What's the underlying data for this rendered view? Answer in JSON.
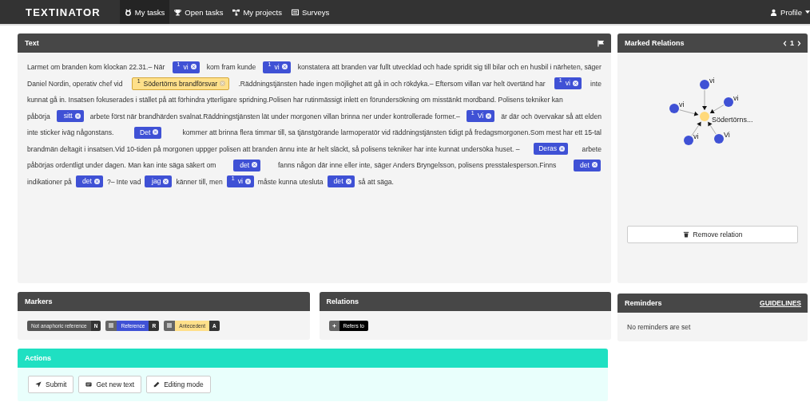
{
  "navbar": {
    "brand": "TEXTINATOR",
    "items": [
      {
        "label": "My tasks",
        "selected": true
      },
      {
        "label": "Open tasks",
        "selected": false
      },
      {
        "label": "My projects",
        "selected": false
      },
      {
        "label": "Surveys",
        "selected": false
      }
    ],
    "profile": "Profile"
  },
  "text_panel": {
    "title": "Text",
    "lines": [
      [
        {
          "kind": "text",
          "text": "Larmet om branden kom klockan 22.31.– När"
        },
        {
          "kind": "reference",
          "badge": "1",
          "text": "vi"
        },
        {
          "kind": "text",
          "text": "kom fram kunde"
        },
        {
          "kind": "reference",
          "badge": "1",
          "text": "vi"
        },
        {
          "kind": "text",
          "text": "konstatera att branden var fullt utvecklad och hade spridit sig till bilar och en husbil i närheten, säger"
        }
      ],
      [
        {
          "kind": "text",
          "text": "Daniel Nordin, operativ chef vid"
        },
        {
          "kind": "antecedent",
          "badge": "1",
          "text": "Södertörns brandförsvar"
        },
        {
          "kind": "text",
          "text": ".Räddningstjänsten hade ingen möjlighet att gå in och rökdyka.– Eftersom villan var helt övertänd har"
        },
        {
          "kind": "reference",
          "badge": "1",
          "text": "vi"
        },
        {
          "kind": "text",
          "text": "inte"
        }
      ],
      [
        {
          "kind": "text",
          "text": "kunnat gå in. Insatsen fokuserades i stället på att förhindra ytterligare spridning.Polisen har rutinmässigt inlett en förundersökning om misstänkt mordband. Polisens tekniker kan"
        }
      ],
      [
        {
          "kind": "text",
          "text": "påbörja"
        },
        {
          "kind": "reference",
          "text": "sitt"
        },
        {
          "kind": "text",
          "text": "arbete först när brandhärden svalnat.Räddningstjänsten lät under morgonen villan brinna ner under kontrollerade former.–"
        },
        {
          "kind": "reference",
          "badge": "1",
          "text": "Vi"
        },
        {
          "kind": "text",
          "text": "är där och övervakar så att elden"
        }
      ],
      [
        {
          "kind": "text",
          "text": "inte sticker iväg någonstans."
        },
        {
          "kind": "reference",
          "text": "Det"
        },
        {
          "kind": "text",
          "text": "kommer att brinna flera timmar till, sa tjänstgörande larmoperatör vid räddningstjänsten tidigt på fredagsmorgonen.Som mest har ett 15-tal"
        }
      ],
      [
        {
          "kind": "text",
          "text": "brandmän deltagit i insatsen.Vid 10-tiden på morgonen uppger polisen att branden ännu inte är helt släckt, så polisens tekniker har inte kunnat undersöka huset. –"
        },
        {
          "kind": "reference",
          "text": "Deras"
        },
        {
          "kind": "text",
          "text": "arbete"
        }
      ],
      [
        {
          "kind": "text",
          "text": "påbörjas ordentligt under dagen. Man kan inte säga säkert om"
        },
        {
          "kind": "reference",
          "text": "det"
        },
        {
          "kind": "text",
          "text": "fanns någon där inne eller inte, säger Anders Bryngelsson, polisens presstalesperson.Finns"
        },
        {
          "kind": "reference",
          "text": "det"
        }
      ],
      [
        {
          "kind": "text",
          "text": "indikationer på"
        },
        {
          "kind": "reference",
          "text": "det"
        },
        {
          "kind": "text",
          "text": "?– Inte vad"
        },
        {
          "kind": "reference",
          "text": "jag"
        },
        {
          "kind": "text",
          "text": "känner till, men"
        },
        {
          "kind": "reference",
          "badge": "1",
          "text": "vi"
        },
        {
          "kind": "text",
          "text": "måste kunna utesluta"
        },
        {
          "kind": "reference",
          "text": "det"
        },
        {
          "kind": "text",
          "text": "så att säga."
        }
      ]
    ]
  },
  "marked_relations": {
    "title": "Marked Relations",
    "page": "1",
    "graph": {
      "nodes": [
        {
          "kind": "reference",
          "label": "vi"
        },
        {
          "kind": "reference",
          "label": "vi"
        },
        {
          "kind": "reference",
          "label": "vi"
        },
        {
          "kind": "antecedent",
          "label": "Södertörns..."
        },
        {
          "kind": "reference",
          "label": "vi"
        },
        {
          "kind": "reference",
          "label": "Vi"
        }
      ]
    },
    "button": "Remove relation"
  },
  "markers": {
    "title": "Markers",
    "items": [
      {
        "kind": "plain",
        "label": "Not anaphoric reference",
        "key": "N"
      },
      {
        "kind": "reference",
        "label": "Reference",
        "key": "R"
      },
      {
        "kind": "antecedent",
        "label": "Antecedent",
        "key": "A"
      }
    ]
  },
  "relations": {
    "title": "Relations",
    "items": [
      {
        "label": "Refers to"
      }
    ]
  },
  "reminders": {
    "title": "Reminders",
    "link": "GUIDELINES",
    "message": "No reminders are set"
  },
  "actions": {
    "title": "Actions",
    "buttons": [
      {
        "label": "Submit"
      },
      {
        "label": "Get new text"
      },
      {
        "label": "Editing mode"
      }
    ]
  }
}
